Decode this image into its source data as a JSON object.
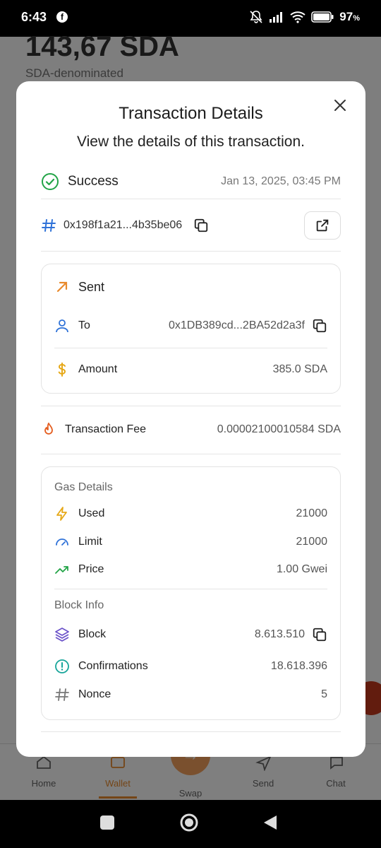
{
  "status": {
    "time": "6:43",
    "battery": "97"
  },
  "background": {
    "balance": "143,67 SDA",
    "subtitle": "SDA-denominated",
    "nav": [
      {
        "label": "Home"
      },
      {
        "label": "Wallet"
      },
      {
        "label": "Swap"
      },
      {
        "label": "Send"
      },
      {
        "label": "Chat"
      }
    ]
  },
  "modal": {
    "title": "Transaction Details",
    "subtitle": "View the details of this transaction.",
    "status": "Success",
    "date": "Jan 13, 2025, 03:45 PM",
    "hash": "0x198f1a21...4b35be06",
    "sent": {
      "label": "Sent",
      "to_label": "To",
      "to_value": "0x1DB389cd...2BA52d2a3f",
      "amount_label": "Amount",
      "amount_value": "385.0 SDA"
    },
    "fee": {
      "label": "Transaction Fee",
      "value": "0.00002100010584 SDA"
    },
    "gas": {
      "title": "Gas Details",
      "used_label": "Used",
      "used_value": "21000",
      "limit_label": "Limit",
      "limit_value": "21000",
      "price_label": "Price",
      "price_value": "1.00 Gwei"
    },
    "block": {
      "title": "Block Info",
      "block_label": "Block",
      "block_value": "8.613.510",
      "conf_label": "Confirmations",
      "conf_value": "18.618.396",
      "nonce_label": "Nonce",
      "nonce_value": "5"
    }
  },
  "colors": {
    "success": "#22a447",
    "accent": "#e98a2c",
    "blue": "#2f72d8",
    "purple": "#6b52c9",
    "teal": "#17a59a"
  }
}
